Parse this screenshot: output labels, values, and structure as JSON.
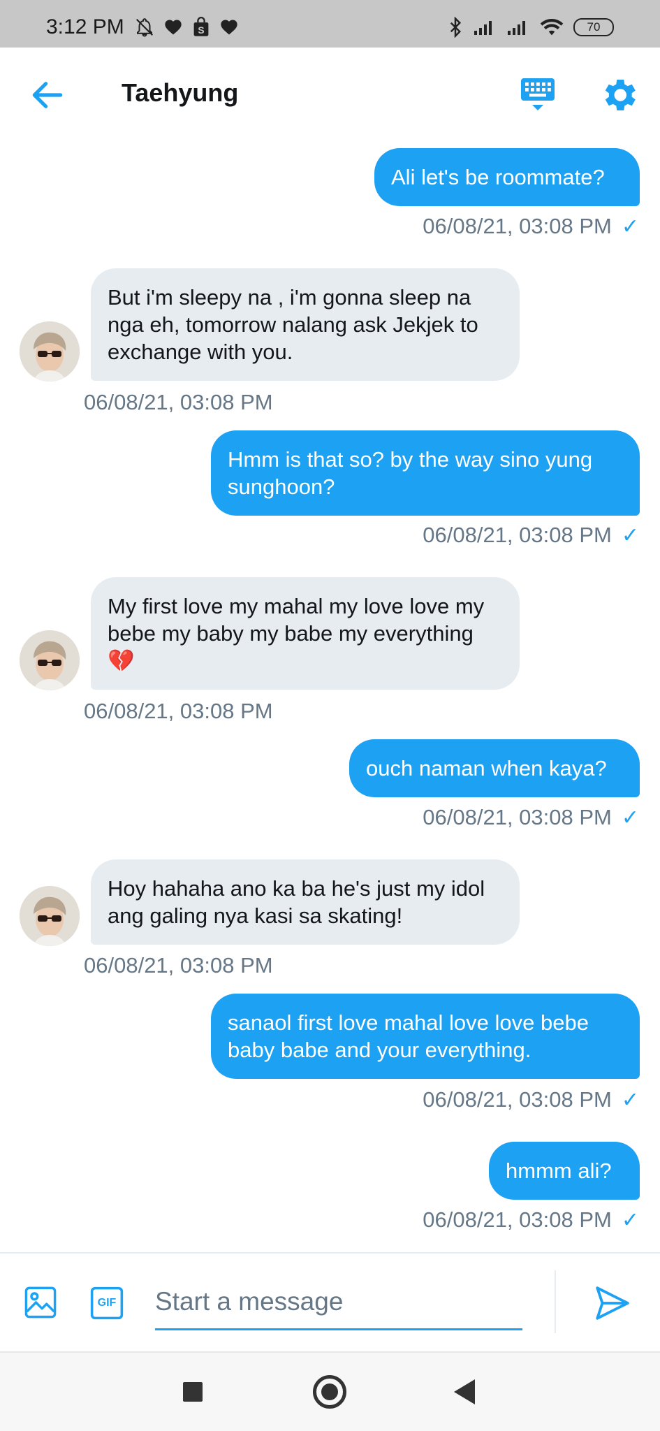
{
  "status_bar": {
    "time": "3:12 PM",
    "battery": "70",
    "left_icons": [
      "bell-off-icon",
      "heart-icon",
      "shopping-bag-icon",
      "heart-icon"
    ],
    "right_icons": [
      "bluetooth-icon",
      "signal-icon",
      "signal-icon",
      "wifi-icon"
    ]
  },
  "header": {
    "title": "Taehyung",
    "icons": [
      "back-arrow-icon",
      "keyboard-icon",
      "gear-icon"
    ]
  },
  "messages": [
    {
      "direction": "outgoing",
      "text": "Ali let's be roommate?",
      "timestamp": "06/08/21, 03:08 PM",
      "read_check": "✓"
    },
    {
      "direction": "incoming",
      "text": "But i'm sleepy na , i'm gonna sleep na nga eh, tomorrow nalang ask Jekjek to exchange with you.",
      "timestamp": "06/08/21, 03:08 PM"
    },
    {
      "direction": "outgoing",
      "text": "Hmm is that so? by the way sino yung sunghoon?",
      "timestamp": "06/08/21, 03:08 PM",
      "read_check": "✓"
    },
    {
      "direction": "incoming",
      "text": "My first love my mahal my love love my bebe my baby my babe my everything 💔",
      "timestamp": "06/08/21, 03:08 PM"
    },
    {
      "direction": "outgoing",
      "text": "ouch naman when kaya?",
      "timestamp": "06/08/21, 03:08 PM",
      "read_check": "✓"
    },
    {
      "direction": "incoming",
      "text": "Hoy hahaha ano ka ba he's just my idol ang galing nya kasi sa skating!",
      "timestamp": "06/08/21, 03:08 PM"
    },
    {
      "direction": "outgoing",
      "text": "sanaol first love mahal love love bebe baby babe and your everything.",
      "timestamp": "06/08/21, 03:08 PM",
      "read_check": "✓"
    },
    {
      "direction": "outgoing",
      "text": "hmmm ali?",
      "timestamp": "06/08/21, 03:08 PM",
      "read_check": "✓"
    }
  ],
  "composer": {
    "placeholder": "Start a message",
    "gif_label": "GIF"
  },
  "colors": {
    "accent": "#1da1f2",
    "incoming_bubble": "#e6ecf0",
    "timestamp": "#657786"
  }
}
